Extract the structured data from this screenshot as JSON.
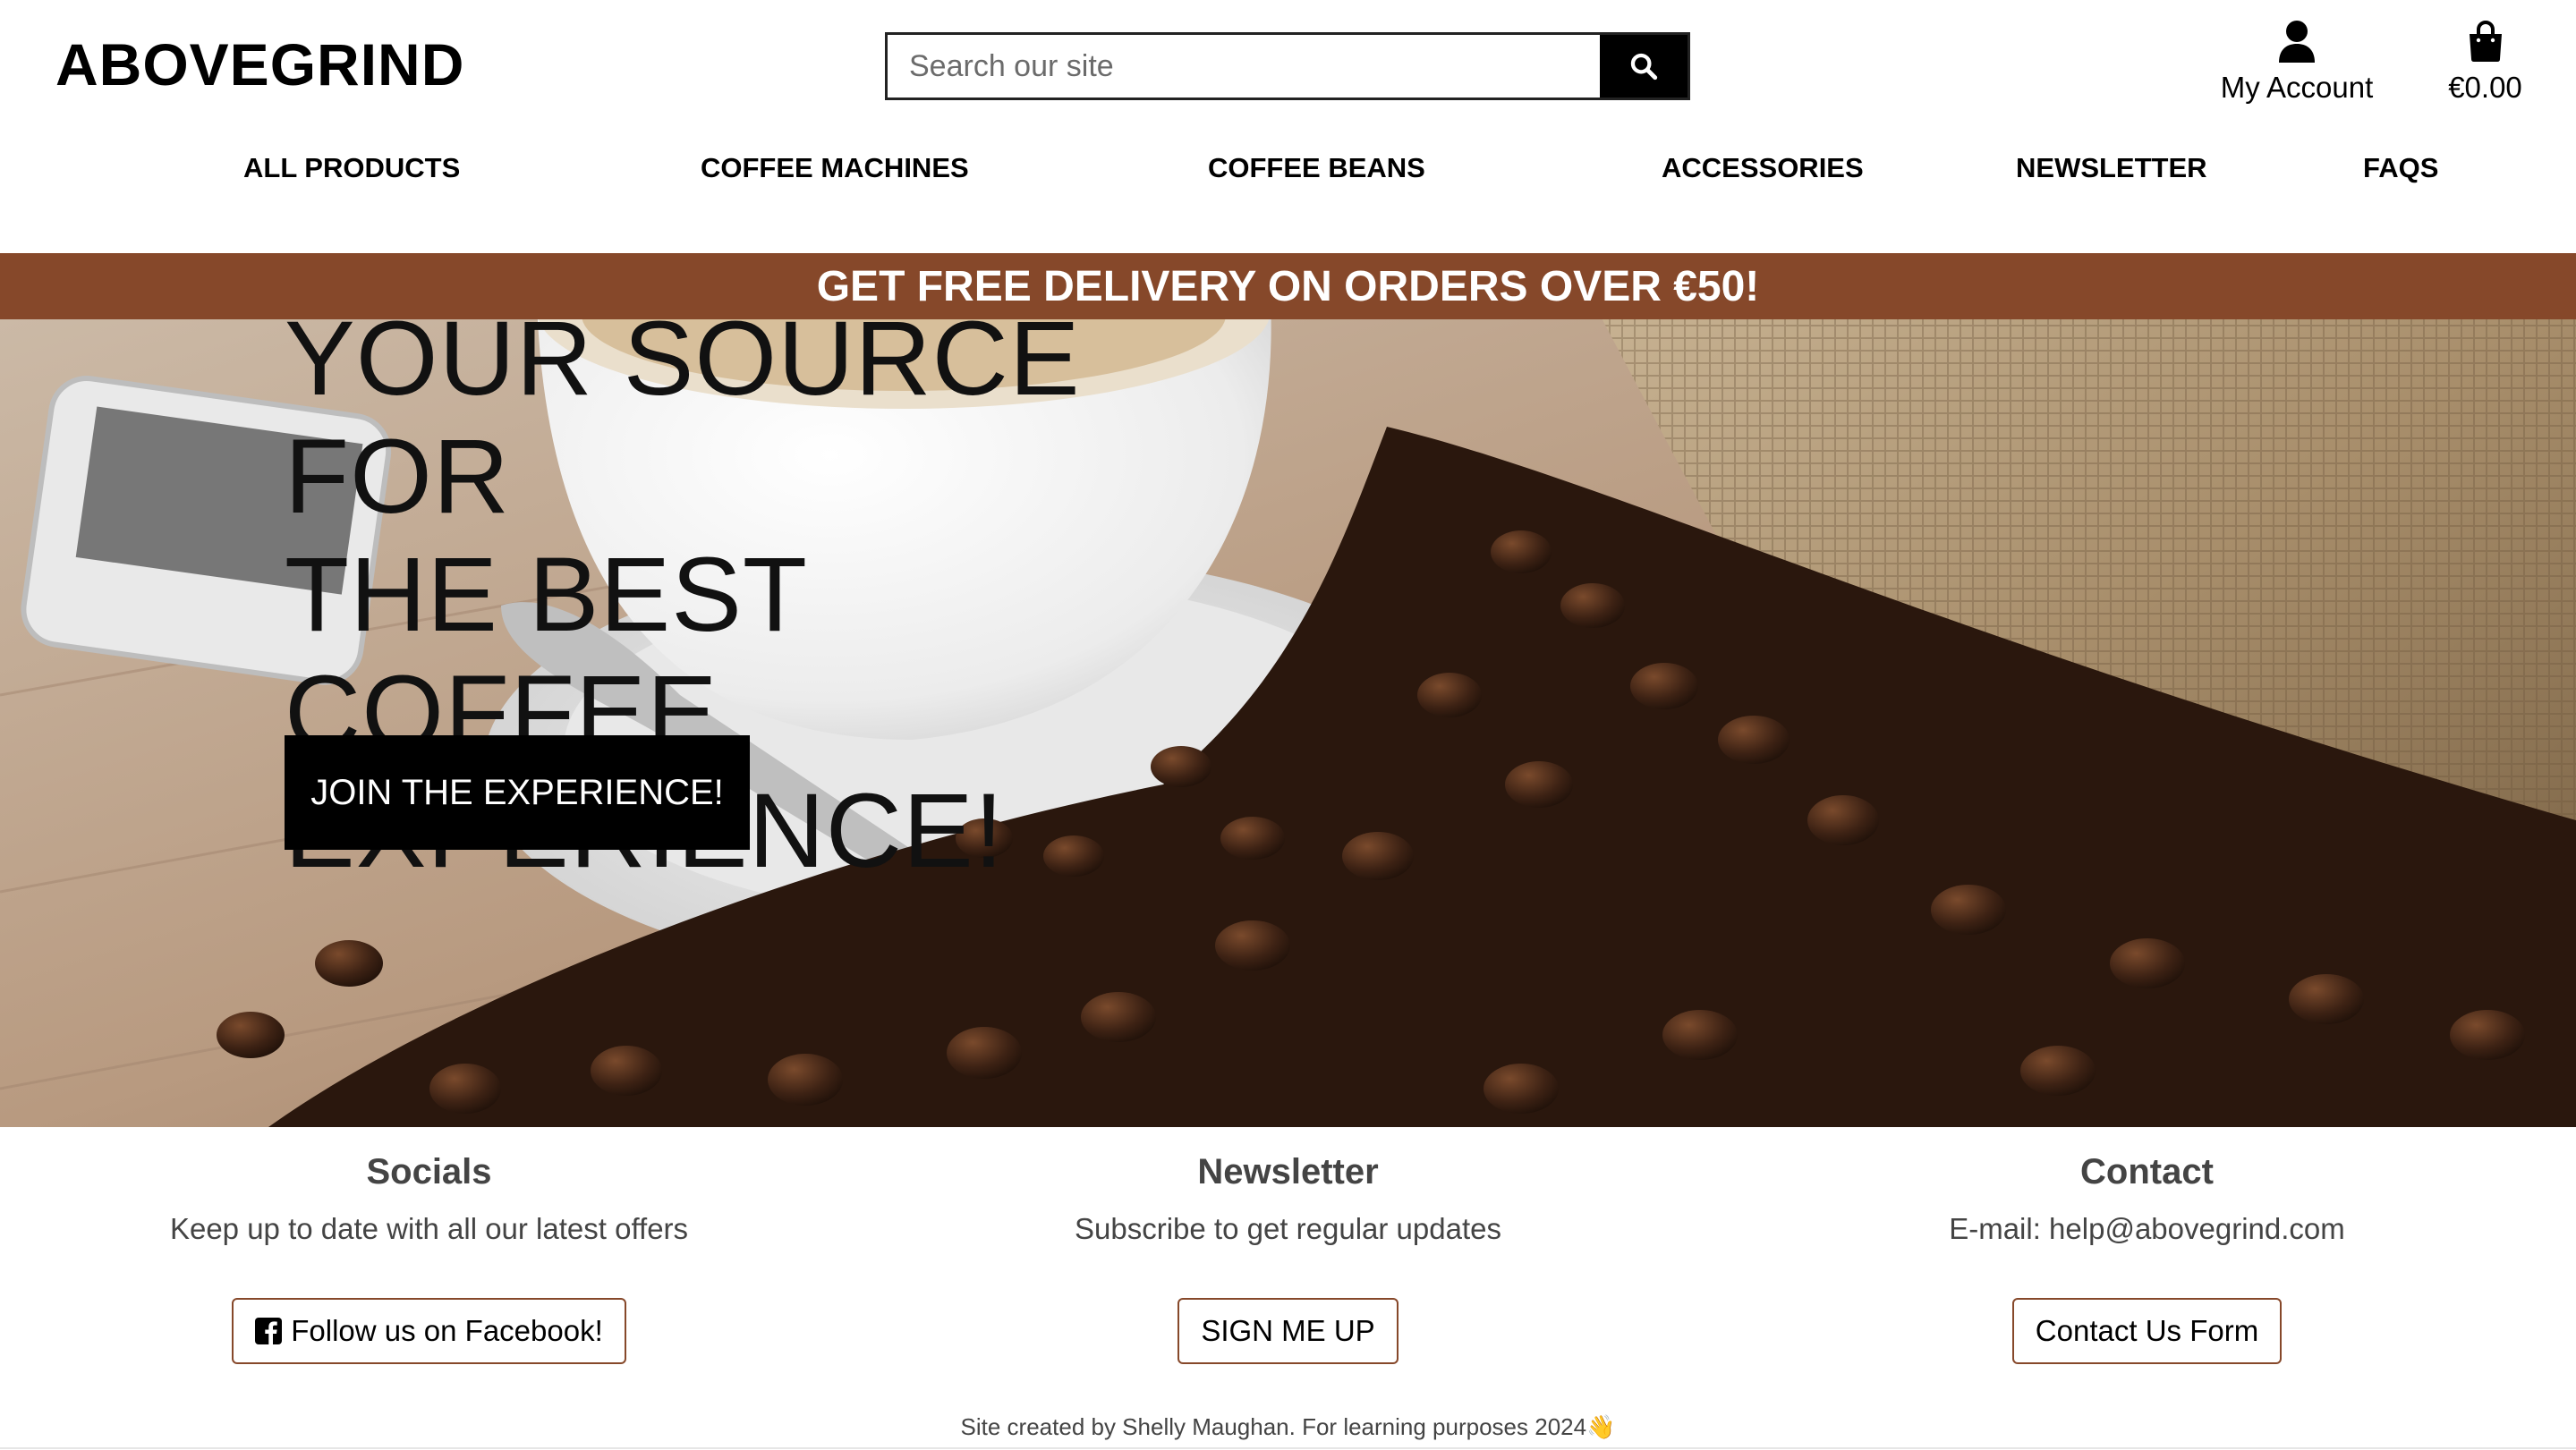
{
  "header": {
    "logo": "ABOVEGRIND",
    "search": {
      "placeholder": "Search our site",
      "button_icon": "search-icon"
    },
    "account": {
      "label": "My Account",
      "icon": "user-icon"
    },
    "cart": {
      "total": "€0.00",
      "icon": "shopping-bag-icon"
    }
  },
  "nav": {
    "items": [
      {
        "label": "ALL PRODUCTS"
      },
      {
        "label": "COFFEE MACHINES"
      },
      {
        "label": "COFFEE BEANS"
      },
      {
        "label": "ACCESSORIES"
      },
      {
        "label": "NEWSLETTER"
      },
      {
        "label": "FAQS"
      }
    ]
  },
  "promo": {
    "text": "GET FREE DELIVERY ON ORDERS OVER €50!"
  },
  "hero": {
    "lines": [
      "YOUR SOURCE FOR",
      "THE BEST COFFEE",
      "EXPERIENCE!"
    ],
    "cta": "JOIN THE EXPERIENCE!"
  },
  "footer": {
    "socials": {
      "title": "Socials",
      "text": "Keep up to date with all our latest offers",
      "button": "Follow us on Facebook!",
      "button_icon": "facebook-square-icon"
    },
    "newsletter": {
      "title": "Newsletter",
      "text": "Subscribe to get regular updates",
      "button": "SIGN ME UP"
    },
    "contact": {
      "title": "Contact",
      "text": "E-mail: help@abovegrind.com",
      "button": "Contact Us Form"
    },
    "credit": "Site created by Shelly Maughan. For learning purposes 2024👋"
  },
  "colors": {
    "brand_brown": "#86482a",
    "text_dark": "#000000",
    "text_muted": "#444444"
  }
}
